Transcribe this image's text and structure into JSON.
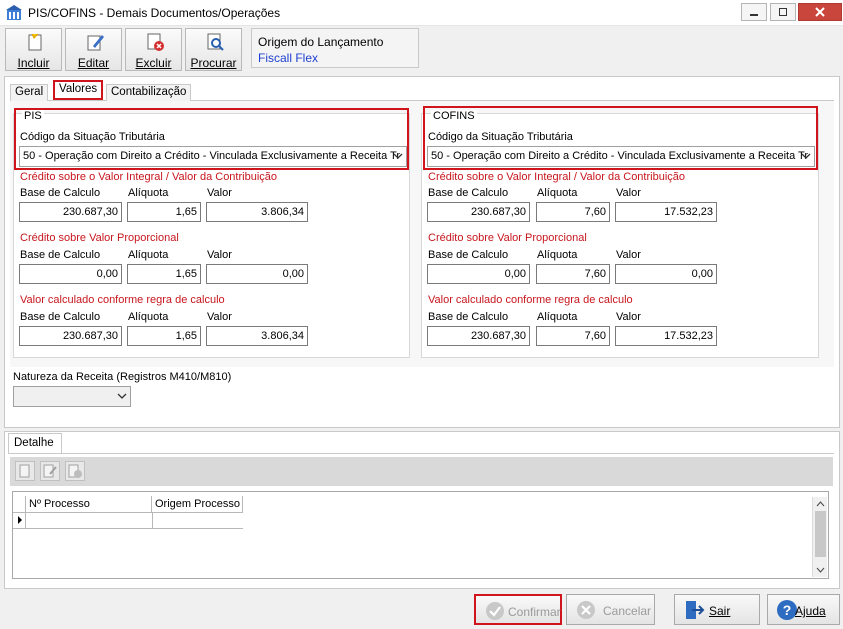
{
  "window": {
    "title": "PIS/COFINS - Demais Documentos/Operações"
  },
  "toolbar": {
    "incluir": "Incluir",
    "editar": "Editar",
    "excluir": "Excluir",
    "procurar": "Procurar"
  },
  "origem": {
    "label": "Origem do Lançamento",
    "value": "Fiscall Flex"
  },
  "tabs": [
    "Geral",
    "Valores",
    "Contabilização"
  ],
  "pis": {
    "group_title": "PIS",
    "cst_label": "Código da Situação Tributária",
    "cst_value": "50 - Operação com Direito a Crédito - Vinculada Exclusivamente a Receita Tr",
    "sec1_title": "Crédito sobre o Valor Integral / Valor da Contribuição",
    "sec2_title": "Crédito sobre Valor Proporcional",
    "sec3_title": "Valor calculado conforme regra de calculo",
    "base_label": "Base de Calculo",
    "aliq_label": "Alíquota",
    "valor_label": "Valor",
    "rows": [
      {
        "base": "230.687,30",
        "aliq": "1,65",
        "valor": "3.806,34"
      },
      {
        "base": "0,00",
        "aliq": "1,65",
        "valor": "0,00"
      },
      {
        "base": "230.687,30",
        "aliq": "1,65",
        "valor": "3.806,34"
      }
    ]
  },
  "cofins": {
    "group_title": "COFINS",
    "cst_label": "Código da Situação Tributária",
    "cst_value": "50 - Operação com Direito a Crédito - Vinculada Exclusivamente a Receita Tr",
    "sec1_title": "Crédito sobre o Valor Integral / Valor da Contribuição",
    "sec2_title": "Crédito sobre Valor Proporcional",
    "sec3_title": "Valor calculado conforme regra de calculo",
    "base_label": "Base de Calculo",
    "aliq_label": "Alíquota",
    "valor_label": "Valor",
    "rows": [
      {
        "base": "230.687,30",
        "aliq": "7,60",
        "valor": "17.532,23"
      },
      {
        "base": "0,00",
        "aliq": "7,60",
        "valor": "0,00"
      },
      {
        "base": "230.687,30",
        "aliq": "7,60",
        "valor": "17.532,23"
      }
    ]
  },
  "natureza": {
    "label": "Natureza da Receita (Registros M410/M810)",
    "value": ""
  },
  "detalhe": {
    "tab": "Detalhe",
    "columns": [
      "Nº Processo",
      "Origem Processo"
    ]
  },
  "buttons": {
    "confirmar": "Confirmar",
    "cancelar": "Cancelar",
    "sair": "Sair",
    "ajuda": "Ajuda"
  },
  "colors": {
    "highlight": "#d0141c",
    "section_red": "#c8161e",
    "link_blue": "#1e3fd0"
  }
}
